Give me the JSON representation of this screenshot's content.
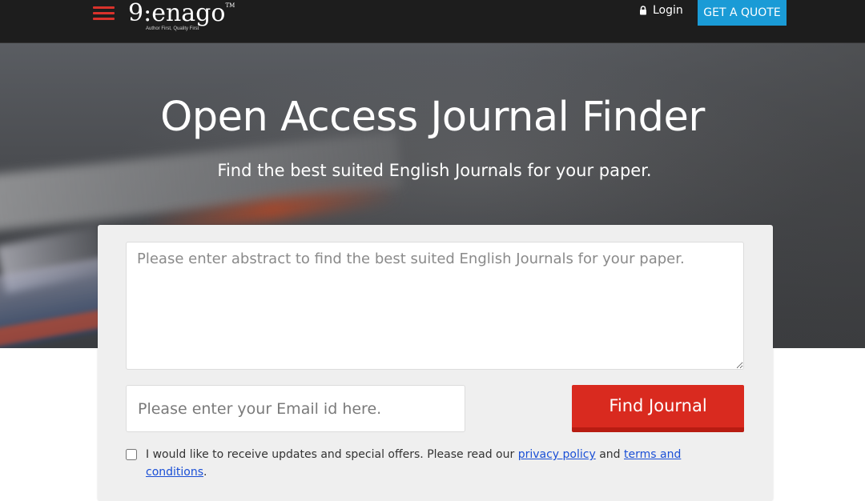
{
  "header": {
    "logo_text": "enago",
    "logo_mark": "9:",
    "logo_tm": "TM",
    "logo_tagline": "Author First, Quality First",
    "login_label": "Login",
    "quote_label": "GET A QUOTE",
    "menu_icon": "hamburger-menu-icon",
    "login_icon": "lock-icon"
  },
  "hero": {
    "title": "Open Access Journal Finder",
    "subtitle": "Find the best suited English Journals for your paper."
  },
  "form": {
    "abstract_placeholder": "Please enter abstract to find the best suited English Journals for your paper.",
    "abstract_value": "",
    "email_placeholder": "Please enter your Email id here.",
    "email_value": "",
    "find_button_label": "Find Journal",
    "consent": {
      "checked": false,
      "text_before": "I would like to receive updates and special offers. Please read our ",
      "privacy_link": "privacy policy",
      "text_middle": " and ",
      "terms_link": "terms and conditions",
      "text_after": "."
    }
  },
  "colors": {
    "header_bg": "#1d1d1d",
    "menu_accent": "#d9322b",
    "quote_bg": "#1a9bd6",
    "find_button_bg": "#d92a1f",
    "link": "#1a4fd6",
    "card_bg": "#efefef"
  }
}
